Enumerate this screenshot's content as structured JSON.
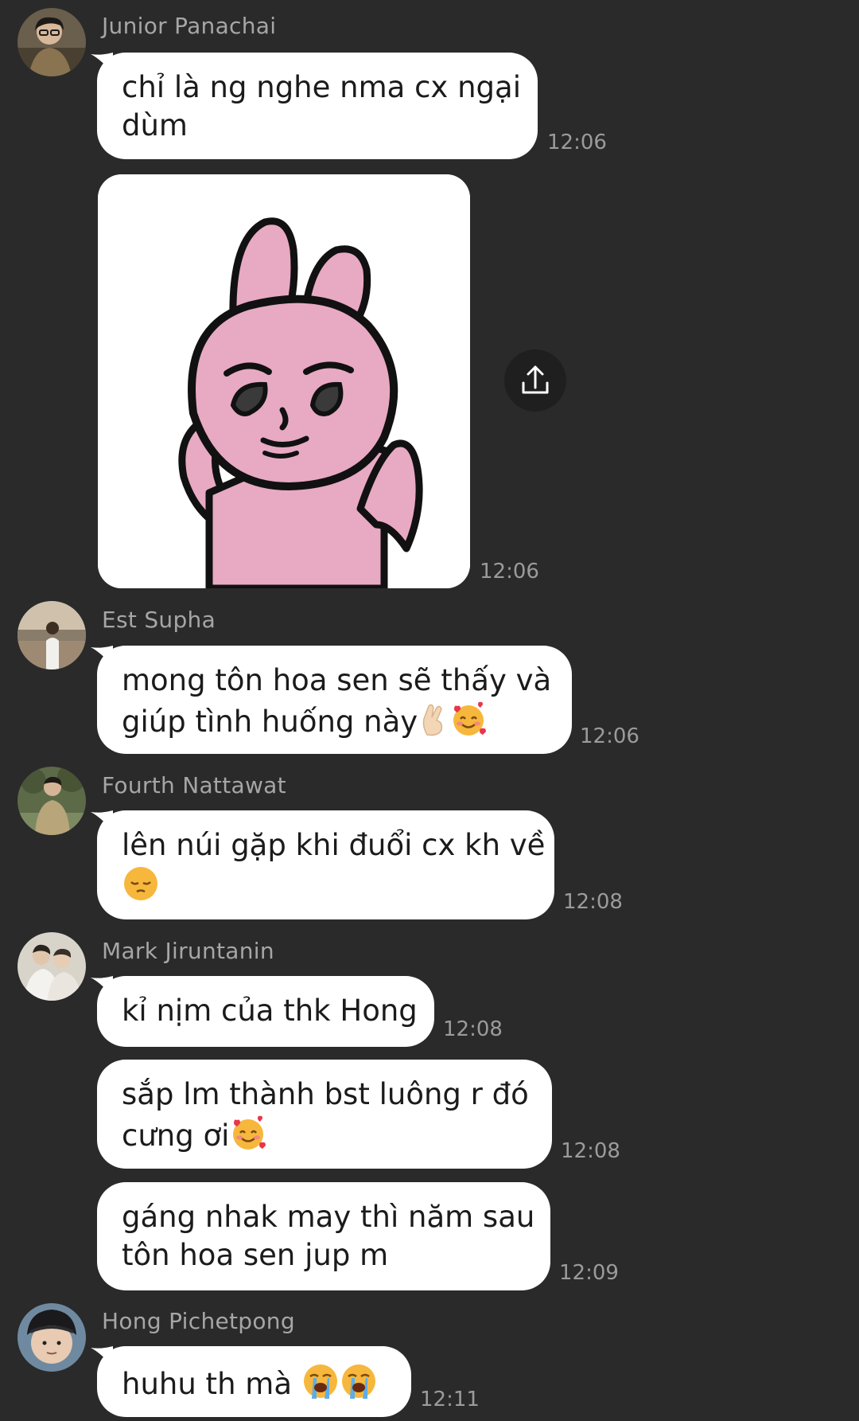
{
  "messages": [
    {
      "sender": "Junior Panachai",
      "lines": [
        "chỉ là ng nghe nma cx ngại",
        "dùm"
      ],
      "time": "12:06"
    },
    {
      "sticker": "pink-bunny-sticker",
      "time": "12:06"
    },
    {
      "sender": "Est Supha",
      "lines": [
        "mong tôn hoa sen sẽ thấy và",
        "giúp tình huống này"
      ],
      "emojis": [
        "crossed-fingers",
        "smiling-face-with-hearts"
      ],
      "time": "12:06"
    },
    {
      "sender": "Fourth Nattawat",
      "lines": [
        "lên núi gặp khi đuổi cx kh về"
      ],
      "emojis": [
        "pensive-face"
      ],
      "time": "12:08"
    },
    {
      "sender": "Mark Jiruntanin",
      "lines": [
        "kỉ nịm của thk Hong"
      ],
      "time": "12:08"
    },
    {
      "lines": [
        "sắp lm thành bst luông r đó",
        "cưng ơi"
      ],
      "emojis": [
        "smiling-face-with-hearts"
      ],
      "time": "12:08"
    },
    {
      "lines": [
        "gáng nhak may thì năm sau",
        "tôn hoa sen jup m"
      ],
      "time": "12:09"
    },
    {
      "sender": "Hong Pichetpong",
      "lines": [
        "huhu th mà"
      ],
      "emojis": [
        "loudly-crying-face",
        "loudly-crying-face"
      ],
      "time": "12:11"
    }
  ],
  "colors": {
    "background": "#2a2a2b",
    "bubble": "#ffffff",
    "meta_text": "#a6a6a6",
    "sticker_pink": "#e8a9c3"
  }
}
